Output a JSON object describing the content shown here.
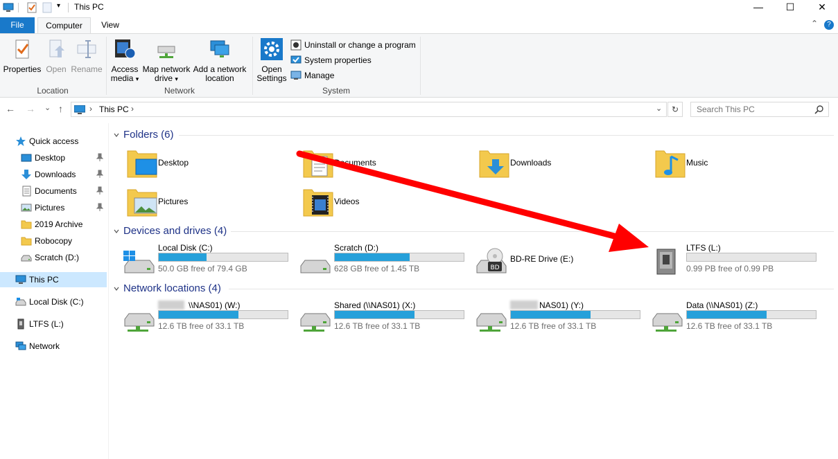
{
  "window": {
    "title": "This PC",
    "qat_dropdown": "▾",
    "controls": {
      "minimize": "—",
      "maximize": "☐",
      "close": "✕"
    }
  },
  "ribbon": {
    "tabs": [
      {
        "label": "File",
        "active": false
      },
      {
        "label": "Computer",
        "active": true
      },
      {
        "label": "View",
        "active": false
      }
    ],
    "location": {
      "group_label": "Location",
      "properties": "Properties",
      "open": "Open",
      "rename": "Rename"
    },
    "network": {
      "group_label": "Network",
      "access_media_1": "Access",
      "access_media_2": "media",
      "map_drive_1": "Map network",
      "map_drive_2": "drive",
      "add_location_1": "Add a network",
      "add_location_2": "location",
      "dropdown_arrow": "▾"
    },
    "system": {
      "group_label": "System",
      "open_settings_1": "Open",
      "open_settings_2": "Settings",
      "uninstall": "Uninstall or change a program",
      "system_properties": "System properties",
      "manage": "Manage"
    },
    "collapse_glyph": "⌃",
    "help_glyph": "?"
  },
  "navigation": {
    "back": "←",
    "forward": "→",
    "recent": "⌄",
    "up": "↑",
    "breadcrumb_sep": "›",
    "address": "This PC",
    "address_dropdown": "⌄",
    "refresh": "↻",
    "search_placeholder": "Search This PC"
  },
  "sidebar": {
    "quick_access": "Quick access",
    "quick_items": [
      {
        "label": "Desktop",
        "icon": "desktop-icon",
        "pinned": true
      },
      {
        "label": "Downloads",
        "icon": "downloads-icon",
        "pinned": true
      },
      {
        "label": "Documents",
        "icon": "documents-icon",
        "pinned": true
      },
      {
        "label": "Pictures",
        "icon": "pictures-icon",
        "pinned": true
      },
      {
        "label": "2019 Archive",
        "icon": "folder-icon",
        "pinned": false
      },
      {
        "label": "Robocopy",
        "icon": "folder-icon",
        "pinned": false
      },
      {
        "label": "Scratch (D:)",
        "icon": "drive-icon",
        "pinned": false
      }
    ],
    "this_pc": "This PC",
    "local_disk": "Local Disk (C:)",
    "ltfs": "LTFS (L:)",
    "network": "Network"
  },
  "content": {
    "folders_header": "Folders (6)",
    "folders": [
      {
        "label": "Desktop",
        "icon": "desktop-folder-icon"
      },
      {
        "label": "Documents",
        "icon": "documents-folder-icon"
      },
      {
        "label": "Downloads",
        "icon": "downloads-folder-icon"
      },
      {
        "label": "Music",
        "icon": "music-folder-icon"
      },
      {
        "label": "Pictures",
        "icon": "pictures-folder-icon"
      },
      {
        "label": "Videos",
        "icon": "videos-folder-icon"
      }
    ],
    "devices_header": "Devices and drives (4)",
    "devices": [
      {
        "name": "Local Disk (C:)",
        "free": "50.0 GB free of 79.4 GB",
        "used_fraction": 0.37
      },
      {
        "name": "Scratch (D:)",
        "free": "628 GB free of 1.45 TB",
        "used_fraction": 0.58
      },
      {
        "name": "BD-RE Drive (E:)"
      },
      {
        "name": "LTFS (L:)",
        "free": "0.99 PB free of 0.99 PB",
        "used_fraction": 0.0
      }
    ],
    "network_header": "Network locations (4)",
    "network_locations": [
      {
        "name": "\\\\NAS01) (W:)",
        "free": "12.6 TB free of 33.1 TB",
        "used_fraction": 0.62
      },
      {
        "name": "Shared (\\\\NAS01) (X:)",
        "free": "12.6 TB free of 33.1 TB",
        "used_fraction": 0.62
      },
      {
        "name": "NAS01) (Y:)",
        "free": "12.6 TB free of 33.1 TB",
        "used_fraction": 0.62
      },
      {
        "name": "Data (\\\\NAS01) (Z:)",
        "free": "12.6 TB free of 33.1 TB",
        "used_fraction": 0.62
      }
    ]
  },
  "colors": {
    "accent": "#1979ca",
    "section_title": "#1e3287",
    "bar_fill": "#26a0da",
    "annotation_arrow": "#ff0000"
  }
}
